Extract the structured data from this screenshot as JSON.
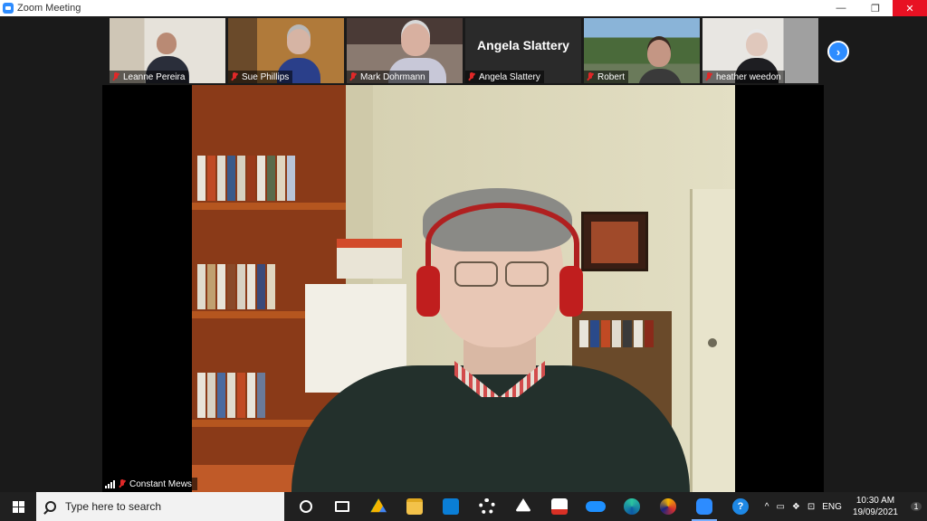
{
  "window": {
    "title": "Zoom Meeting",
    "minimize": "—",
    "restore": "❐",
    "close": "✕"
  },
  "participants": [
    {
      "name": "Leanne Pereira"
    },
    {
      "name": "Sue Phillips"
    },
    {
      "name": "Mark Dohrmann"
    },
    {
      "name": "Angela Slattery",
      "video_off": true
    },
    {
      "name": "Robert"
    },
    {
      "name": "heather weedon"
    }
  ],
  "next_page": "›",
  "speaker": {
    "name": "Constant Mews"
  },
  "taskbar": {
    "search_placeholder": "Type here to search",
    "apps": [
      "cortana",
      "task-view",
      "google-drive",
      "file-explorer",
      "store",
      "settings",
      "inkscape",
      "gmail",
      "onedrive",
      "edge",
      "vpn",
      "zoom",
      "help"
    ],
    "tray": {
      "chevron": "^",
      "language": "ENG",
      "time": "10:30 AM",
      "date": "19/09/2021",
      "notifications": "1"
    }
  },
  "colors": {
    "accent": "#2d8cff",
    "close": "#e81123",
    "mute": "#e02828",
    "taskbar": "#202020"
  }
}
